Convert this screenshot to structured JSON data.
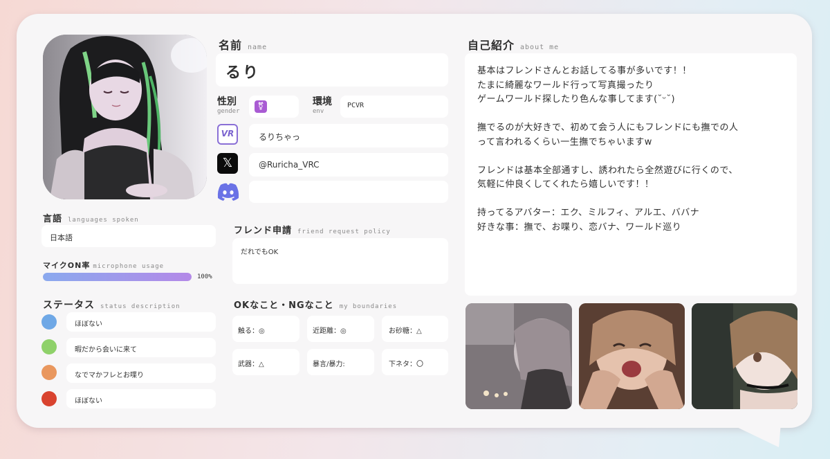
{
  "name": {
    "label": "名前",
    "sub": "name",
    "value": "るり"
  },
  "gender": {
    "label": "性別",
    "sub": "gender",
    "value": "⚧"
  },
  "env": {
    "label": "環境",
    "sub": "env",
    "value": "PCVR"
  },
  "social": {
    "vrchat_icon": "VR",
    "vrchat": "るりちゃっ",
    "x_icon": "𝕏",
    "x": "@Ruricha_VRC",
    "discord": ""
  },
  "languages": {
    "label": "言語",
    "sub": "languages spoken",
    "value": "日本語"
  },
  "mic": {
    "label": "マイクON率",
    "sub": "microphone usage",
    "value": "100%",
    "level": 1.0
  },
  "status": {
    "label": "ステータス",
    "sub": "status description",
    "items": [
      {
        "color": "#6fa8e6",
        "text": "ほぼない"
      },
      {
        "color": "#8fd16a",
        "text": "暇だから会いに来て"
      },
      {
        "color": "#e9975e",
        "text": "なでマかフレとお喋り"
      },
      {
        "color": "#d9432f",
        "text": "ほぼない"
      }
    ]
  },
  "friend_request": {
    "label": "フレンド申請",
    "sub": "friend request policy",
    "value": "だれでもOK"
  },
  "boundaries": {
    "label": "OKなこと・NGなこと",
    "sub": "my boundaries",
    "items": [
      "触る：◎",
      "近距離：◎",
      "お砂糖：△",
      "武器：△",
      "暴言/暴力:",
      "下ネタ：〇"
    ]
  },
  "about": {
    "label": "自己紹介",
    "sub": "about me",
    "lines": [
      "基本はフレンドさんとお話してる事が多いです！！",
      "たまに綺麗なワールド行って写真撮ったり",
      "ゲームワールド探したり色んな事してます(˘ᵕ˘)",
      "",
      "撫でるのが大好きで、初めて会う人にもフレンドにも撫での人",
      "って言われるくらい一生撫でちゃいますw",
      "",
      "フレンドは基本全部通すし、誘われたら全然遊びに行くので、",
      "気軽に仲良くしてくれたら嬉しいです！！",
      "",
      "持ってるアバター：エク、ミルフィ、アルエ、ババナ",
      "好きな事：撫で、お喋り、恋バナ、ワールド巡り"
    ]
  },
  "colors": {
    "mic_bar_start": "#8aa9ee",
    "mic_bar_end": "#b489e8",
    "gender_badge": "#a95bd3",
    "discord": "#6a72e6"
  }
}
